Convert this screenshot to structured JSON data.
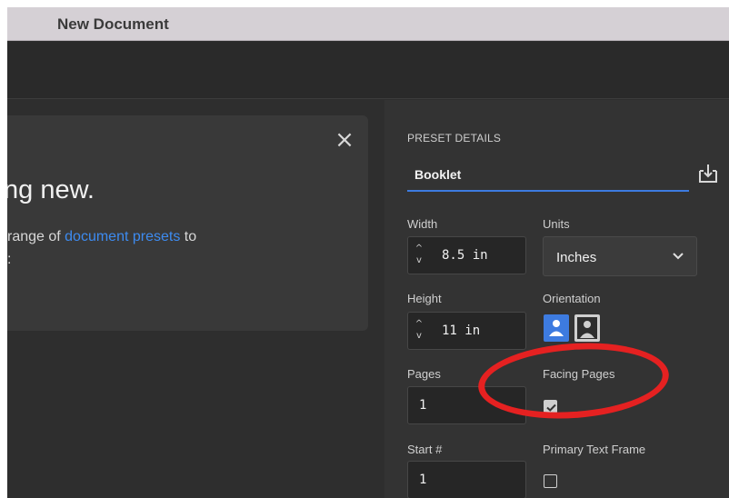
{
  "window": {
    "title": "New Document"
  },
  "card": {
    "headline": "ng new.",
    "desc_before": "range of ",
    "desc_link": "document presets",
    "desc_after": " to",
    "desc_cont": ":"
  },
  "panel": {
    "section_label": "PRESET DETAILS",
    "preset_name": "Booklet",
    "width": {
      "label": "Width",
      "value": "8.5 in"
    },
    "units": {
      "label": "Units",
      "value": "Inches"
    },
    "height": {
      "label": "Height",
      "value": "11 in"
    },
    "orientation": {
      "label": "Orientation",
      "selected": "portrait"
    },
    "pages": {
      "label": "Pages",
      "value": "1"
    },
    "facing_pages": {
      "label": "Facing Pages",
      "checked": true
    },
    "start": {
      "label": "Start #",
      "value": "1"
    },
    "primary_text_frame": {
      "label": "Primary Text Frame",
      "checked": false
    }
  },
  "colors": {
    "accent": "#3d7be0",
    "link": "#3d8bf0",
    "annotation": "#e52121"
  }
}
